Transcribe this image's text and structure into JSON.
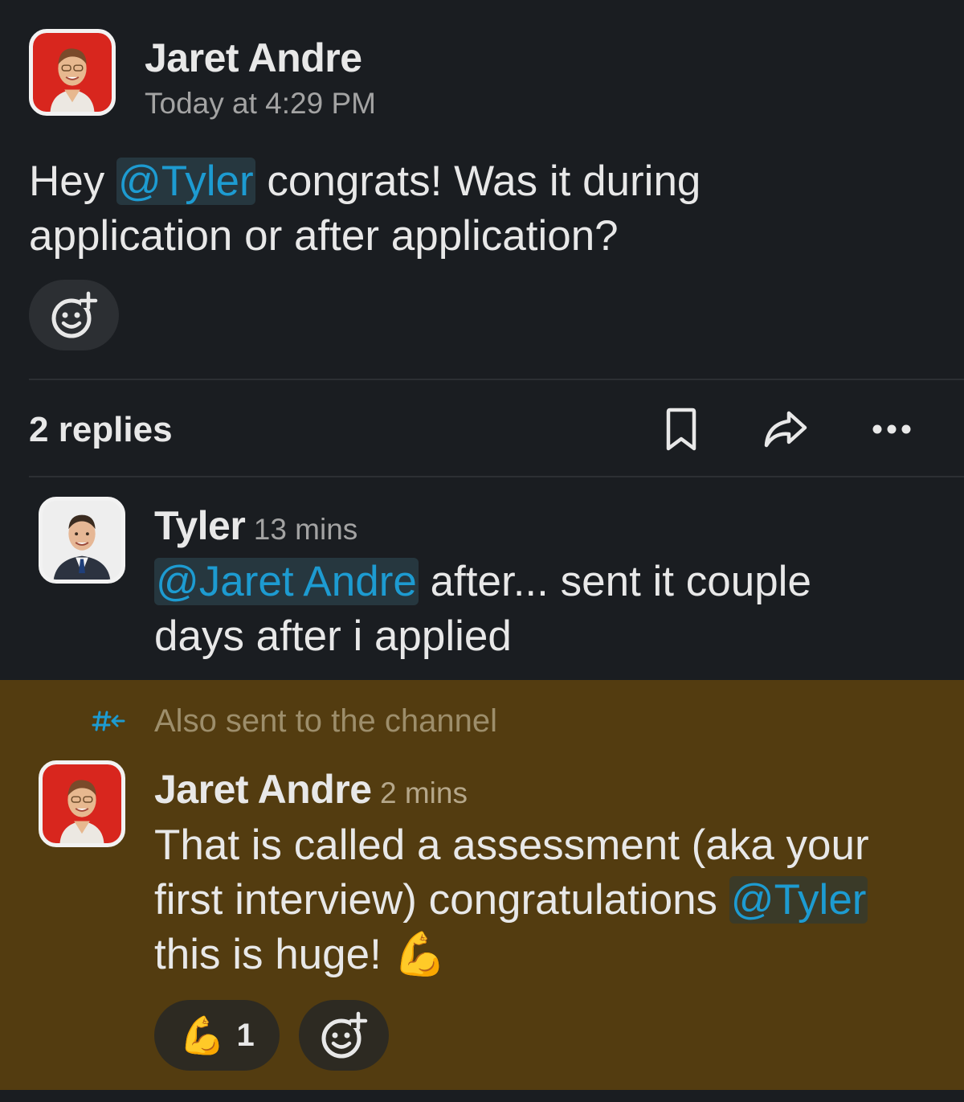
{
  "parent": {
    "author": "Jaret Andre",
    "timestamp": "Today at 4:29 PM",
    "text_pre": "Hey ",
    "mention": "@Tyler",
    "text_post_line1": " congrats! Was it during",
    "text_line2": "application or after application?"
  },
  "thread_bar": {
    "replies_label": "2 replies"
  },
  "replies": [
    {
      "author": "Tyler",
      "time": "13 mins",
      "mention": "@Jaret Andre",
      "text_line1": " after... sent it couple",
      "text_line2": "days after i applied"
    },
    {
      "channel_note": "Also sent to the channel",
      "author": "Jaret Andre",
      "time": "2 mins",
      "text_line1": "That is called a assessment (aka your",
      "text_line2_pre": "first interview) congratulations ",
      "mention": "@Tyler",
      "text_line3": "this is huge! ",
      "emoji": "💪",
      "reaction": {
        "emoji": "💪",
        "count": "1"
      }
    }
  ],
  "icons": [
    "add-reaction-icon",
    "bookmark-icon",
    "share-icon",
    "more-icon",
    "channel-icon",
    "flexed-biceps-emoji"
  ],
  "colors": {
    "background": "#1a1d21",
    "mention": "#1d9bd1",
    "highlight": "#533c10",
    "avatar_red": "#d8261e"
  }
}
